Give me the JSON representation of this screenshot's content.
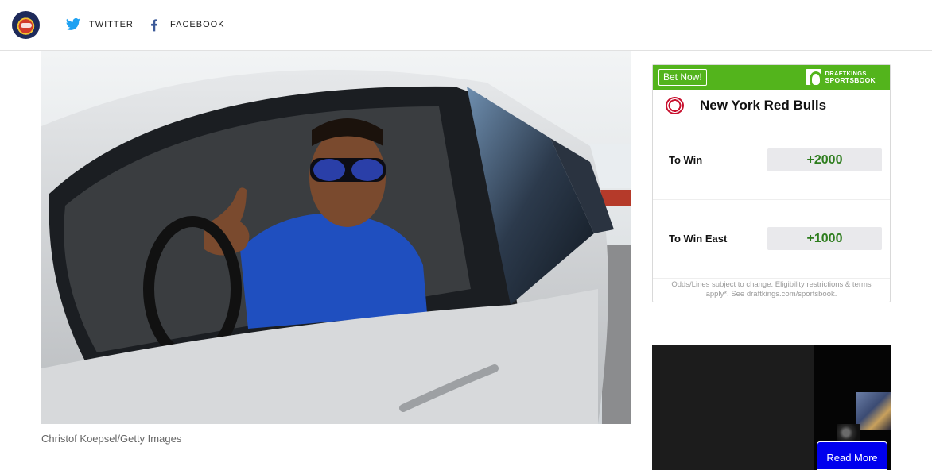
{
  "header": {
    "logo_name": "site-logo",
    "social": [
      {
        "label": "TWITTER",
        "icon": "twitter-bird-icon",
        "color": "#1da1f2"
      },
      {
        "label": "FACEBOOK",
        "icon": "facebook-f-icon",
        "color": "#3b5998"
      }
    ]
  },
  "hero": {
    "caption": "Christof Koepsel/Getty Images"
  },
  "odds_widget": {
    "bet_label": "Bet Now!",
    "sponsor_line1": "DRAFTKINGS",
    "sponsor_line2": "SPORTSBOOK",
    "accent_color": "#53b41c",
    "team": "New York Red Bulls",
    "lines": [
      {
        "label": "To Win",
        "odds": "+2000"
      },
      {
        "label": "To Win East",
        "odds": "+1000"
      }
    ],
    "disclaimer": "Odds/Lines subject to change. Eligibility restrictions & terms apply*. See draftkings.com/sportsbook."
  },
  "video_ad": {
    "read_more": "Read More"
  }
}
